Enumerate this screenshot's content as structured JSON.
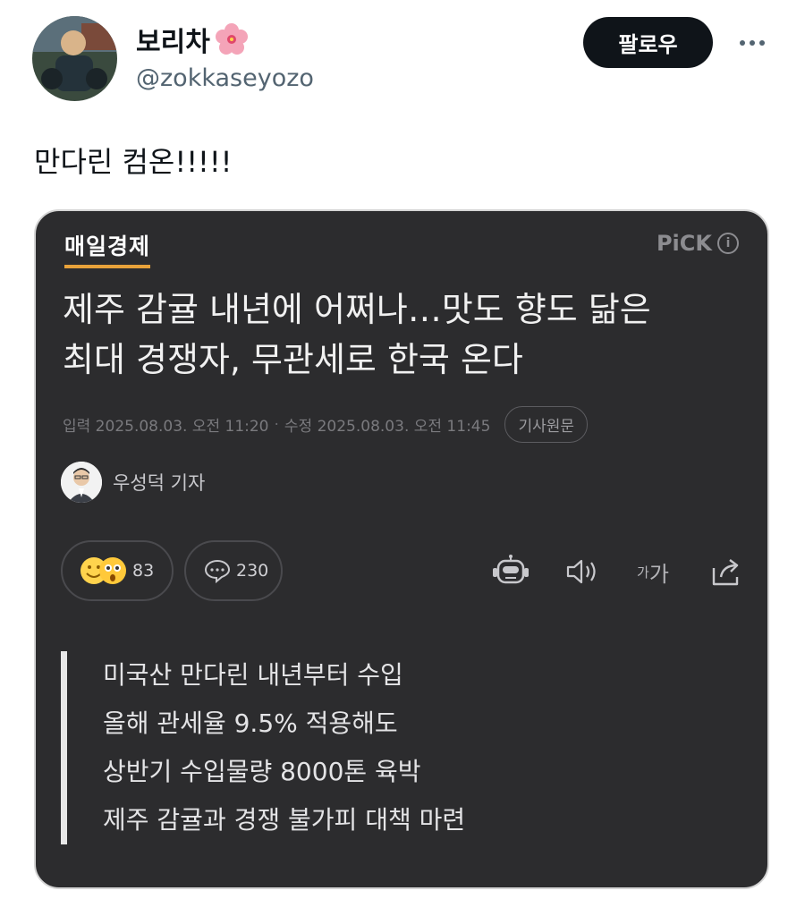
{
  "user": {
    "display_name": "보리차",
    "handle": "@zokkaseyozo"
  },
  "actions": {
    "follow_label": "팔로우"
  },
  "tweet": {
    "text": "만다린 컴온!!!!!"
  },
  "card": {
    "press": "매일경제",
    "pick_label": "PiCK",
    "headline_line1": "제주 감귤 내년에 어쩌나…맛도 향도 닮은",
    "headline_line2": "최대 경쟁자, 무관세로 한국 온다",
    "input_date": "입력 2025.08.03. 오전 11:20",
    "modified_date": "수정 2025.08.03. 오전 11:45",
    "original_label": "기사원문",
    "reporter": "우성덕 기자",
    "reaction_count": "83",
    "comment_count": "230",
    "font_size_label_small": "가",
    "font_size_label_large": "가",
    "summary": [
      "미국산 만다린 내년부터 수입",
      "올해 관세율 9.5% 적용해도",
      "상반기 수입물량 8000톤 육박",
      "제주 감귤과 경쟁 불가피 대책 마련"
    ]
  },
  "colors": {
    "card_bg": "#2c2c2e",
    "press_underline": "#e8a23a",
    "follow_bg": "#0f1419"
  }
}
